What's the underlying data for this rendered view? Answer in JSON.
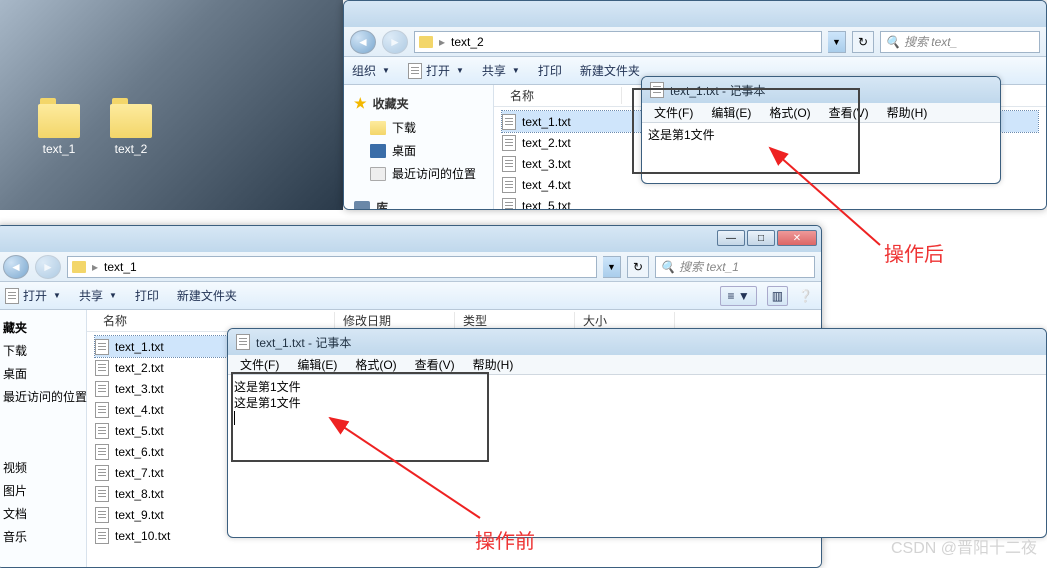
{
  "desktop": {
    "icons": [
      {
        "label": "text_1"
      },
      {
        "label": "text_2"
      }
    ]
  },
  "window1": {
    "path": "text_2",
    "search_placeholder": "搜索 text_",
    "toolbar": {
      "organize": "组织",
      "open": "打开",
      "share": "共享",
      "print": "打印",
      "new_folder": "新建文件夹"
    },
    "sidebar": {
      "fav_header": "收藏夹",
      "items": [
        "下载",
        "桌面",
        "最近访问的位置"
      ],
      "lib_header": "库"
    },
    "colname": "名称",
    "files": [
      "text_1.txt",
      "text_2.txt",
      "text_3.txt",
      "text_4.txt",
      "text_5.txt"
    ]
  },
  "window2": {
    "path": "text_1",
    "search_placeholder": "搜索 text_1",
    "toolbar": {
      "open": "打开",
      "share": "共享",
      "print": "打印",
      "new_folder": "新建文件夹"
    },
    "sidebar_partial": {
      "fav_header": "藏夹",
      "items": [
        "下载",
        "桌面",
        "最近访问的位置"
      ],
      "secondary": [
        "视频",
        "图片",
        "文档",
        "音乐"
      ]
    },
    "columns": {
      "name": "名称",
      "mdate": "修改日期",
      "type": "类型",
      "size": "大小"
    },
    "files": [
      "text_1.txt",
      "text_2.txt",
      "text_3.txt",
      "text_4.txt",
      "text_5.txt",
      "text_6.txt",
      "text_7.txt",
      "text_8.txt",
      "text_9.txt",
      "text_10.txt"
    ]
  },
  "notepad1": {
    "title": "text_1.txt - 记事本",
    "menu": [
      "文件(F)",
      "编辑(E)",
      "格式(O)",
      "查看(V)",
      "帮助(H)"
    ],
    "content": [
      "这是第1文件"
    ]
  },
  "notepad2": {
    "title": "text_1.txt - 记事本",
    "menu": [
      "文件(F)",
      "编辑(E)",
      "格式(O)",
      "查看(V)",
      "帮助(H)"
    ],
    "content": [
      "这是第1文件",
      "这是第1文件"
    ]
  },
  "labels": {
    "after": "操作后",
    "before": "操作前"
  },
  "watermark": "CSDN @晋阳十二夜"
}
